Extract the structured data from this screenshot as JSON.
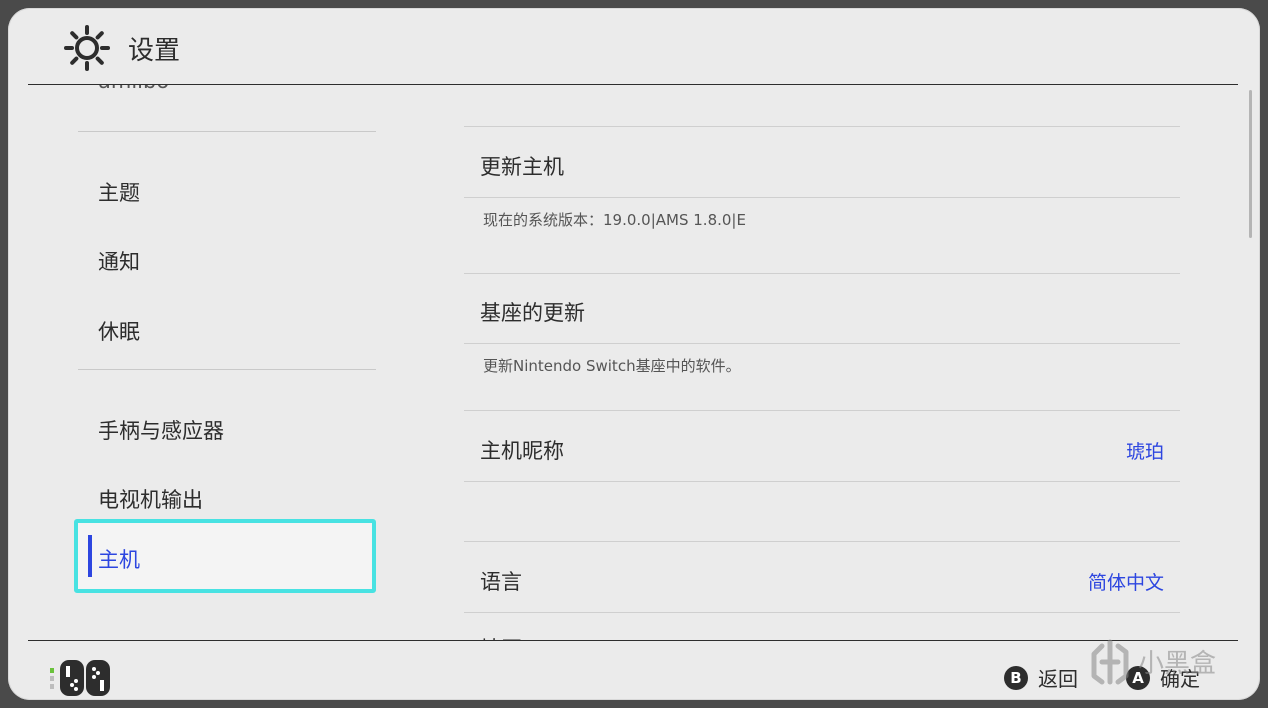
{
  "header": {
    "title": "设置",
    "icon": "gear-icon"
  },
  "sidebar": {
    "cut_item": "amiibo",
    "items": [
      {
        "label": "主题"
      },
      {
        "label": "通知"
      },
      {
        "label": "休眠"
      },
      {
        "label": "手柄与感应器"
      },
      {
        "label": "电视机输出"
      }
    ],
    "selected": {
      "label": "主机"
    }
  },
  "main": {
    "rows": [
      {
        "title": "更新主机",
        "desc": "现在的系统版本：19.0.0|AMS 1.8.0|E"
      },
      {
        "title": "基座的更新",
        "desc": "更新Nintendo Switch基座中的软件。"
      },
      {
        "title": "主机昵称",
        "value": "琥珀"
      },
      {
        "title": "语言",
        "value": "简体中文"
      }
    ],
    "cut_row": "地区"
  },
  "footer": {
    "back": {
      "button": "B",
      "label": "返回"
    },
    "ok": {
      "button": "A",
      "label": "确定"
    }
  },
  "watermark": {
    "text": "小黑盒"
  },
  "colors": {
    "accent": "#2d46e0",
    "highlight": "#48e2e2",
    "background": "#ebebeb"
  }
}
